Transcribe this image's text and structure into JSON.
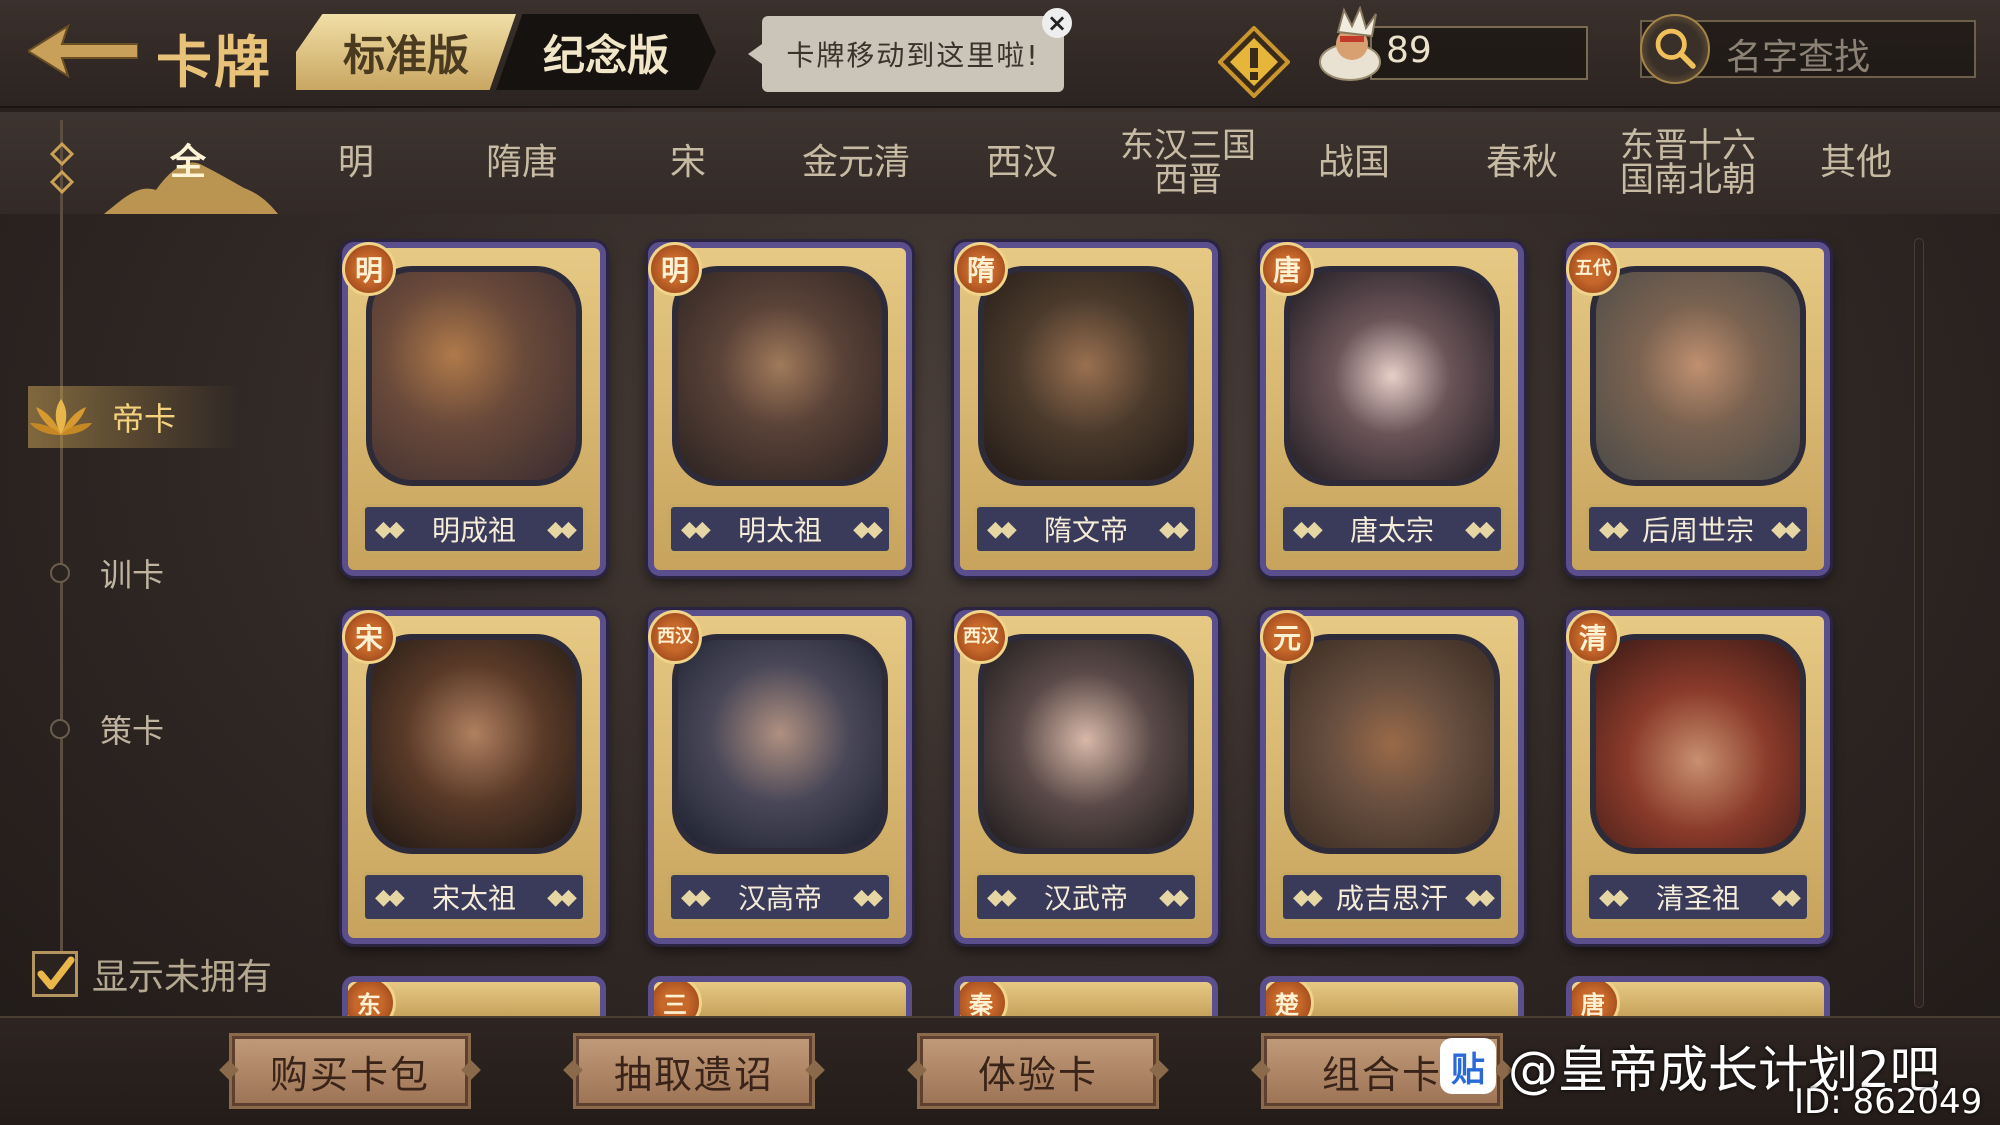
{
  "header": {
    "title": "卡牌",
    "version_tabs": [
      {
        "label": "标准版",
        "active": true
      },
      {
        "label": "纪念版",
        "active": false
      }
    ],
    "tooltip": "卡牌移动到这里啦!",
    "currency_value": "89",
    "search_placeholder": "名字查找"
  },
  "era_tabs": [
    {
      "label": "全",
      "active": true
    },
    {
      "label": "明"
    },
    {
      "label": "隋唐"
    },
    {
      "label": "宋"
    },
    {
      "label": "金元清"
    },
    {
      "label": "西汉"
    },
    {
      "label_line1": "东汉三国",
      "label_line2": "西晋"
    },
    {
      "label": "战国"
    },
    {
      "label": "春秋"
    },
    {
      "label_line1": "东晋十六",
      "label_line2": "国南北朝"
    },
    {
      "label": "其他"
    }
  ],
  "side_nav": {
    "items": [
      {
        "label": "帝卡",
        "active": true
      },
      {
        "label": "训卡"
      },
      {
        "label": "策卡"
      }
    ],
    "show_unowned_label": "显示未拥有",
    "show_unowned_checked": true
  },
  "cards": [
    {
      "name": "明成祖",
      "badge": "明"
    },
    {
      "name": "明太祖",
      "badge": "明"
    },
    {
      "name": "隋文帝",
      "badge": "隋"
    },
    {
      "name": "唐太宗",
      "badge": "唐"
    },
    {
      "name": "后周世宗",
      "badge": "五代"
    },
    {
      "name": "宋太祖",
      "badge": "宋"
    },
    {
      "name": "汉高帝",
      "badge": "西汉"
    },
    {
      "name": "汉武帝",
      "badge": "西汉"
    },
    {
      "name": "成吉思汗",
      "badge": "元"
    },
    {
      "name": "清圣祖",
      "badge": "清"
    }
  ],
  "partial_cards": [
    {
      "badge": "东"
    },
    {
      "badge": "三"
    },
    {
      "badge": "秦"
    },
    {
      "badge": "楚"
    },
    {
      "badge": "唐"
    }
  ],
  "bottom_buttons": [
    {
      "label": "购买卡包"
    },
    {
      "label": "抽取遗诏"
    },
    {
      "label": "体验卡"
    },
    {
      "label": "组合卡"
    }
  ],
  "watermark": {
    "icon_text": "贴",
    "text": "@皇帝成长计划2吧",
    "id": "ID: 862049"
  },
  "colors": {
    "accent_gold": "#e9c27a",
    "card_frame": "#5a4e8c",
    "button": "#c09a78"
  }
}
